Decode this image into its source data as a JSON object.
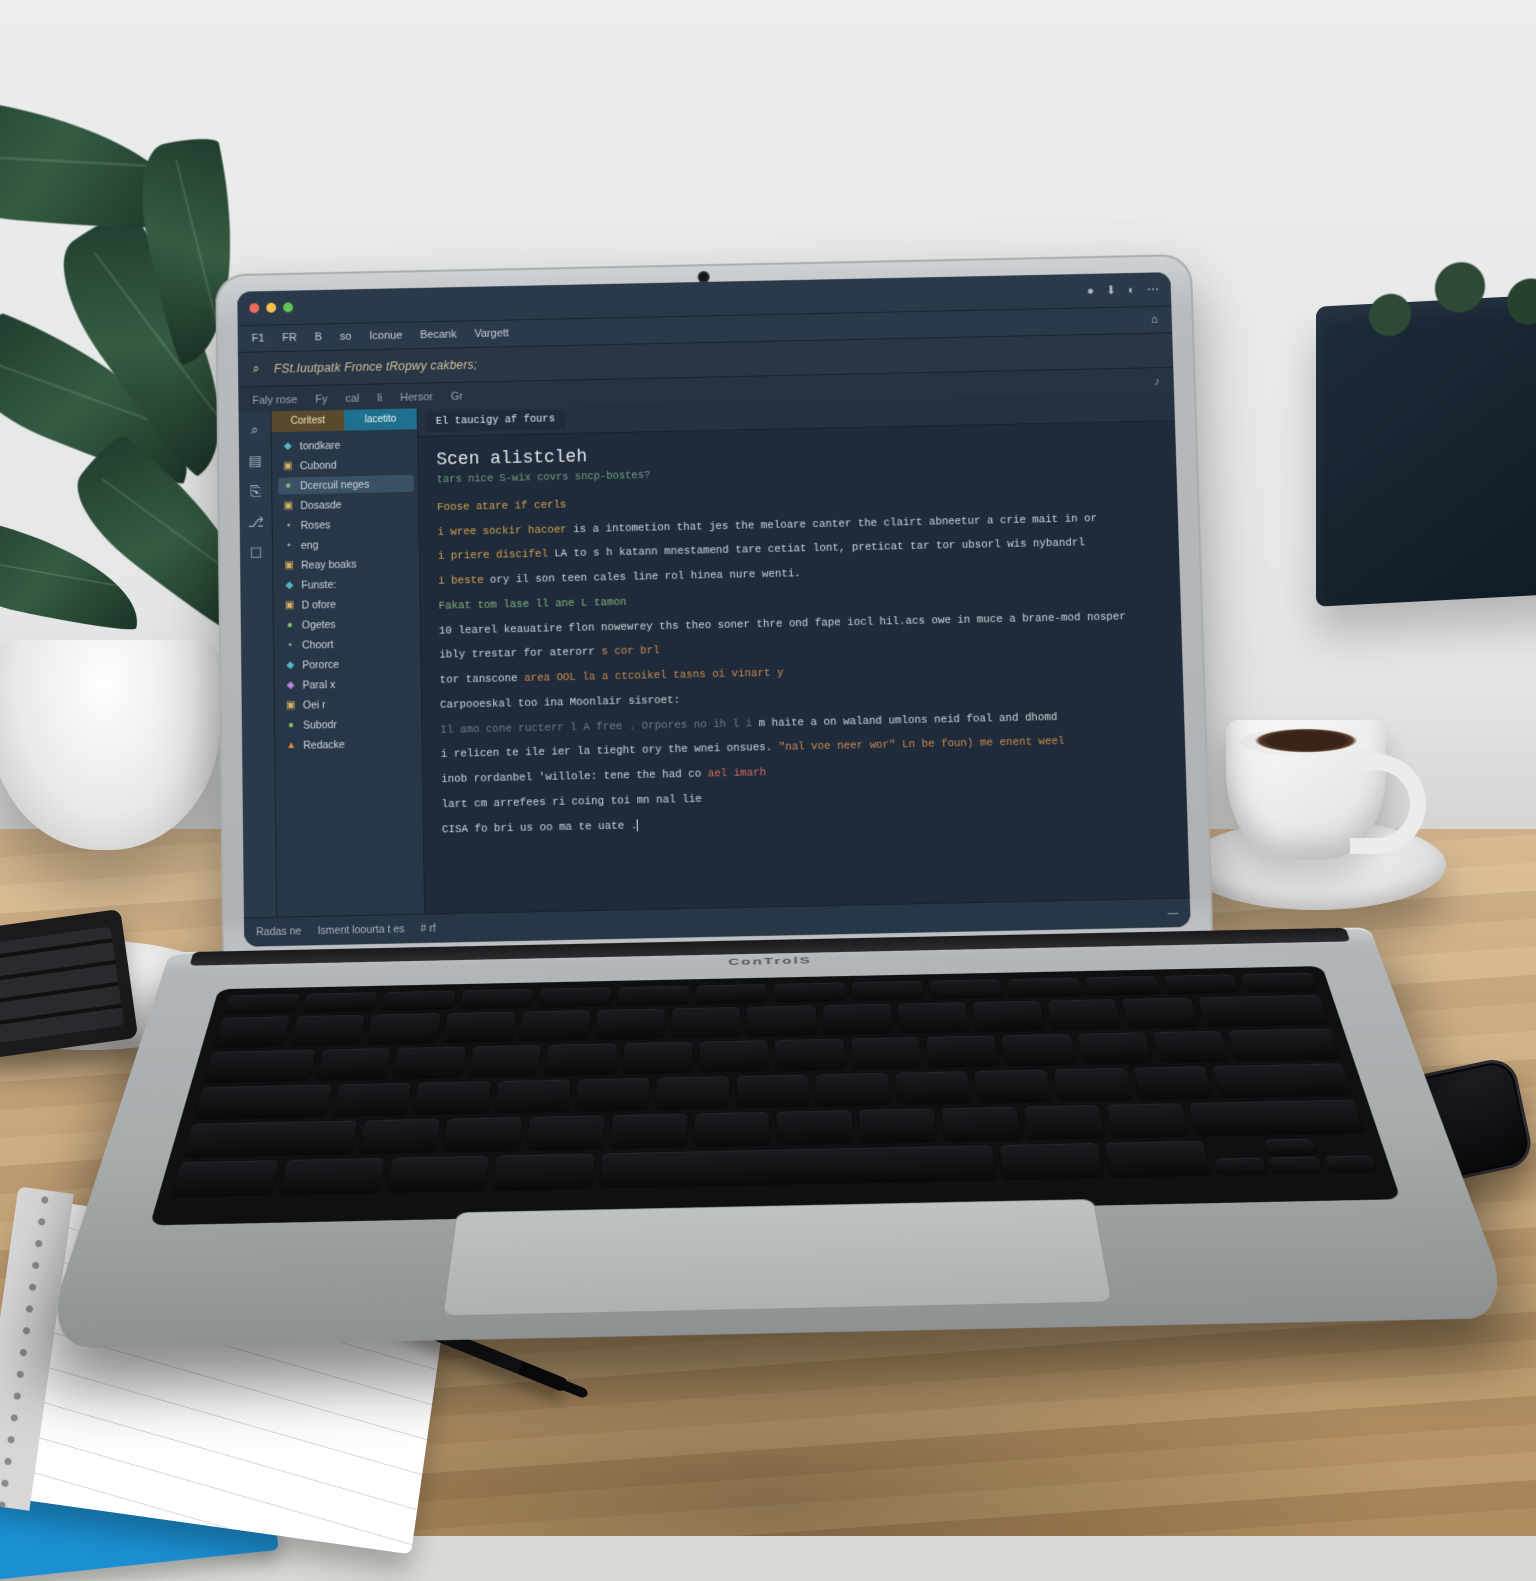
{
  "scene_note": "Photo of a laptop on a wooden desk; the laptop screen shows a dark-theme code-editor/IDE window. Text on screen is stylised and largely illegible; values below are best-effort transcriptions / placeholders.",
  "laptop": {
    "brand": "ConTrolS"
  },
  "window": {
    "tiny_icons": [
      "notif-icon",
      "download-icon",
      "user-icon",
      "more-icon"
    ]
  },
  "menu": {
    "items": [
      "F1",
      "FR",
      "B",
      "so",
      "Iconue",
      "Becank",
      "Vargett"
    ],
    "right": "⌂"
  },
  "title_strip": {
    "icon": "search-icon",
    "title": "FSt.Iuutpatk Fronce tRopwy cakbers;"
  },
  "tab_bar": {
    "items": [
      "Faly rose",
      "Fy",
      "cal",
      "li",
      "Hersor",
      "Gr"
    ],
    "right_icon": "bell-icon"
  },
  "rail_icons": [
    "search-icon",
    "book-icon",
    "clipboard-icon",
    "branch-icon",
    "archive-icon"
  ],
  "sidebar": {
    "top_chips": [
      "Coritest",
      "lacetito"
    ],
    "items": [
      {
        "ic": "teal",
        "label": "tondkare"
      },
      {
        "ic": "amber",
        "label": "Cubond"
      },
      {
        "ic": "green",
        "label": "Dcercuil neges",
        "hl": true
      },
      {
        "ic": "amber",
        "label": "Dosasde"
      },
      {
        "ic": "gray",
        "label": "Roses"
      },
      {
        "ic": "gray",
        "label": "eng"
      },
      {
        "ic": "amber",
        "label": "Reay boaks"
      },
      {
        "ic": "teal",
        "label": "Funste:"
      },
      {
        "ic": "amber",
        "label": "D ofore"
      },
      {
        "ic": "green",
        "label": "Ogetes"
      },
      {
        "ic": "gray",
        "label": "Choort"
      },
      {
        "ic": "teal",
        "label": "Pororce"
      },
      {
        "ic": "purple",
        "label": "Paral x"
      },
      {
        "ic": "amber",
        "label": "Oei r"
      },
      {
        "ic": "green",
        "label": "Subodr"
      },
      {
        "ic": "orange",
        "label": "Redacke"
      }
    ]
  },
  "editor": {
    "tabs": [
      {
        "label": "El taucigy af fours",
        "active": true
      }
    ],
    "title": "Scen alistcleh",
    "subtitle": "tars nice S-wix covrs sncp-bostes?",
    "lines": [
      [
        [
          "kw",
          "Foose atare if cerls"
        ]
      ],
      [
        [
          "kw",
          "i wree sockir hacoer"
        ],
        [
          "id",
          " is a intometion that jes the meloare canter the clairt abneetur a crie mait in or"
        ]
      ],
      [
        [
          "kw",
          "i priere discifel"
        ],
        [
          "id",
          " LA to s h katann mnestamend tare cetiat lont, preticat tar tor ubsorl wis nybandrl"
        ]
      ],
      [
        [
          "kw",
          "i beste"
        ],
        [
          "id",
          " ory il son teen cales line rol hinea nure wenti."
        ]
      ],
      [
        [
          "id",
          ""
        ]
      ],
      [
        [
          "fn",
          "Fakat tom lase ll ane  L tamon"
        ]
      ],
      [
        [
          "id",
          "10 learel keauatire flon nowewrey ths theo soner thre ond fape iocl hil.acs owe in muce a brane-mod nosper"
        ]
      ],
      [
        [
          "id",
          "ibly trestar for aterorr"
        ],
        [
          "str",
          " s cor brl"
        ]
      ],
      [
        [
          "id",
          "tor tanscone "
        ],
        [
          "str",
          "area  OOL  la a ctcoikel tasns oi vinart y"
        ]
      ],
      [
        [
          "id",
          "Carpooeskal too ina Moonlair sisroet:"
        ]
      ],
      [
        [
          "id",
          ""
        ]
      ],
      [
        [
          "comm",
          "Il amo cone ructerr l A free . Orpores no ih l i"
        ],
        [
          "id",
          "   m haite a on waland umlons neid foal and  dhomd"
        ]
      ],
      [
        [
          "id",
          "i relicen  te ile ier la tieght ory the wnei onsues. "
        ],
        [
          "str",
          "\"nal voe neer  wor\" Ln be foun) me enent weel"
        ]
      ],
      [
        [
          "id",
          "inob rordanbel 'willole: tene the had co"
        ],
        [
          "err",
          " ael imarh"
        ]
      ],
      [
        [
          "id",
          "lart cm arrefees ri coing toi mn nal lie"
        ]
      ],
      [
        [
          "id",
          ""
        ]
      ],
      [
        [
          "id",
          "CISA fo  bri  us oo ma te uate ."
        ]
      ]
    ]
  },
  "status": {
    "left": [
      "Radas ne",
      "Isment loourta t es",
      "# rf"
    ],
    "right": "—"
  }
}
